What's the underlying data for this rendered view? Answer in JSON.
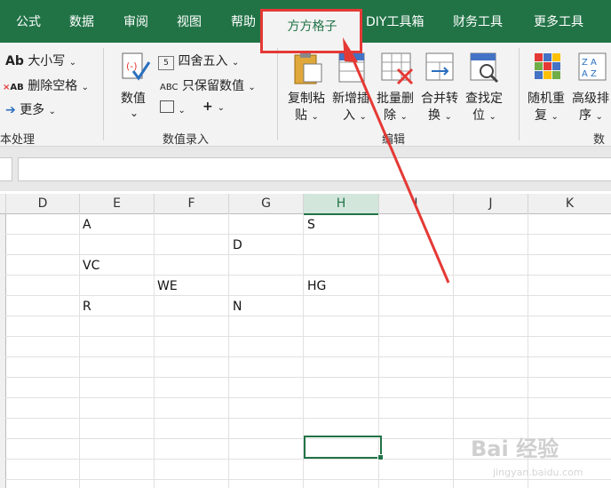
{
  "tabs": {
    "formula": "公式",
    "data": "数据",
    "review": "审阅",
    "view": "视图",
    "help": "帮助",
    "fangfang": "方方格子",
    "diy": "DIY工具箱",
    "finance": "财务工具",
    "more": "更多工具"
  },
  "ribbon": {
    "case_label": "大小写",
    "delete_spaces_label": "删除空格",
    "more_label": "更多",
    "text_group_label": "本处理",
    "number_label": "数值",
    "round_label": "四舍五入",
    "keep_number_label": "只保留数值",
    "number_entry_group_label": "数值录入",
    "copy_paste_label1": "复制粘",
    "copy_paste_label2": "贴",
    "insert_label1": "新增插",
    "insert_label2": "入",
    "batch_delete_label1": "批量删",
    "batch_delete_label2": "除",
    "merge_label1": "合并转",
    "merge_label2": "换",
    "find_label1": "查找定",
    "find_label2": "位",
    "edit_group_label": "编辑",
    "random_label1": "随机重",
    "random_label2": "复",
    "sort_label1": "高级排",
    "sort_label2": "序",
    "data_group_label": "数据"
  },
  "columns": [
    "D",
    "E",
    "F",
    "G",
    "H",
    "I",
    "J",
    "K"
  ],
  "cells": {
    "e1": "A",
    "h1": "S",
    "g2": "D",
    "e3": "VC",
    "f4": "WE",
    "h4": "HG",
    "e5": "R",
    "g5": "N"
  },
  "colors": {
    "tab_bar": "#217346",
    "highlight": "#e53935",
    "selection": "#217346"
  },
  "watermark": {
    "text": "Bai 经验",
    "sub": "jingyan.baidu.com"
  }
}
